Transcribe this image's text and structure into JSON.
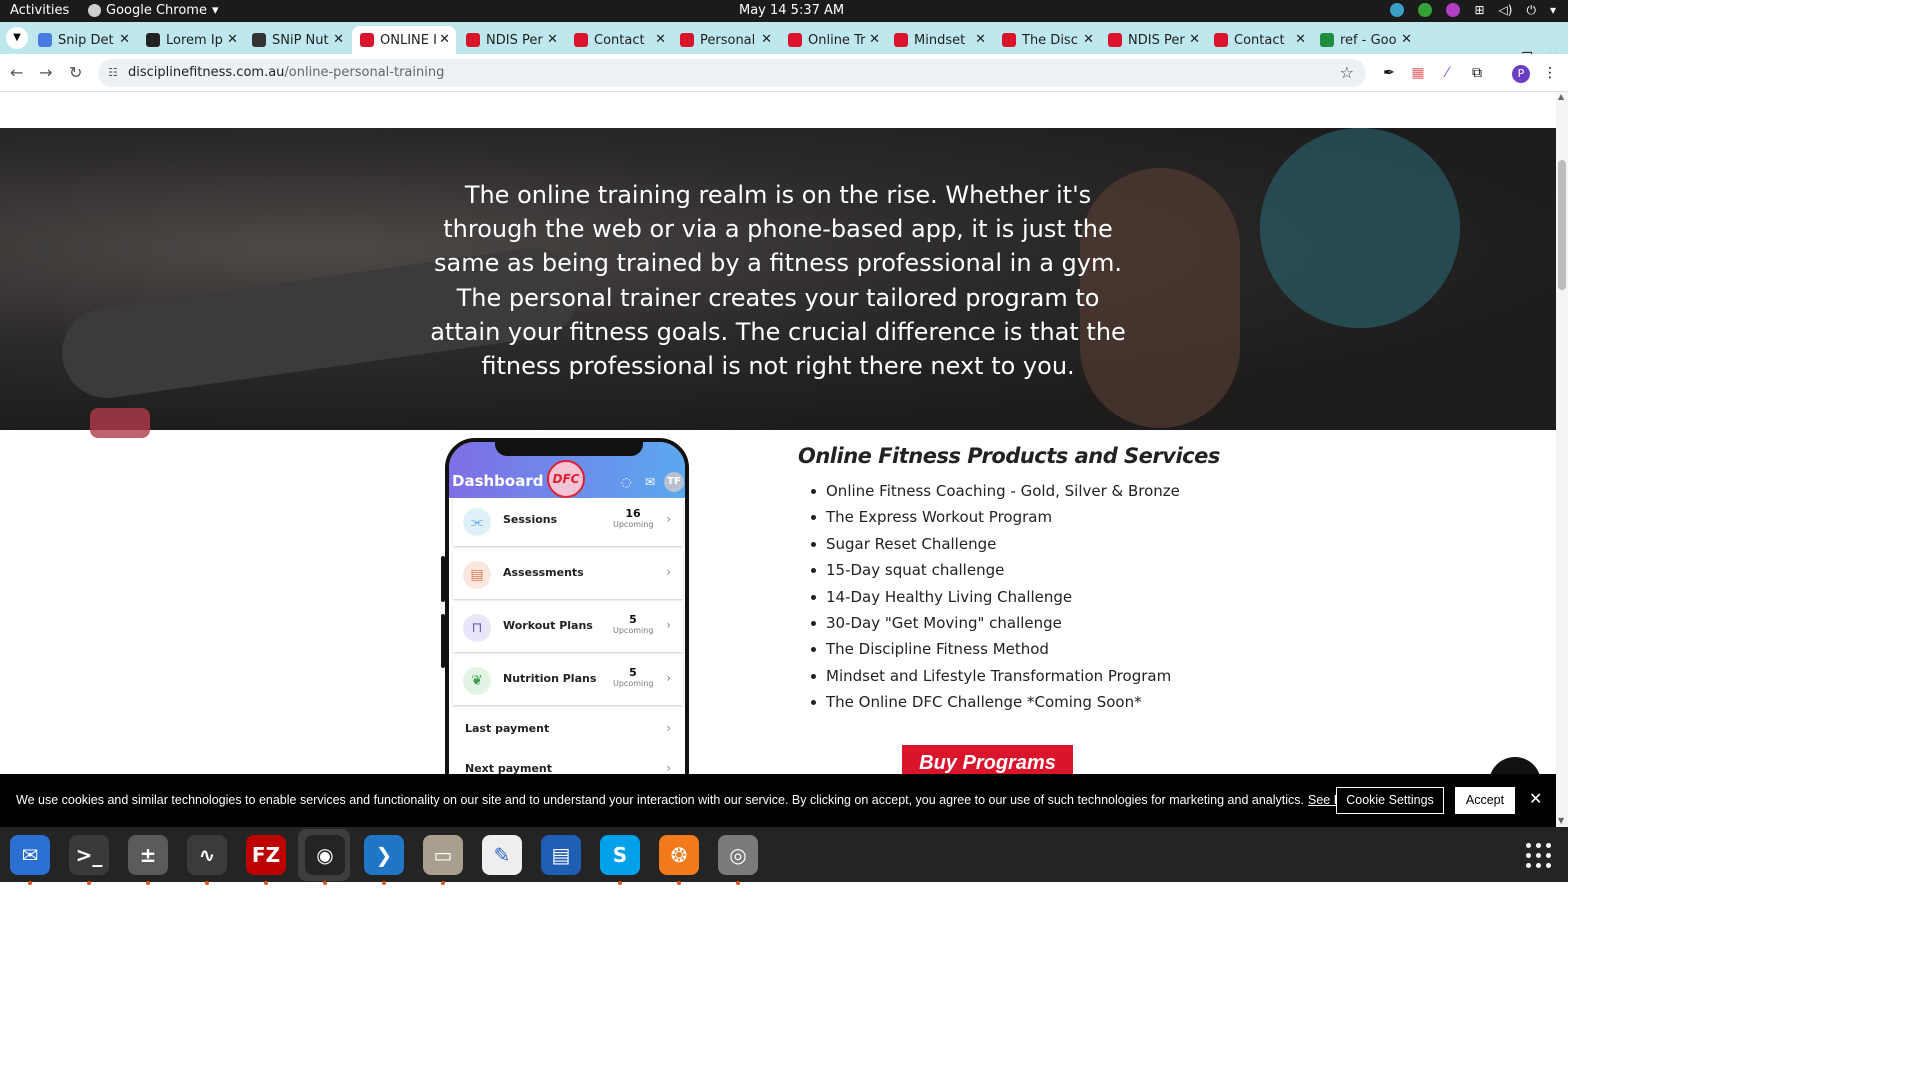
{
  "system": {
    "activities": "Activities",
    "app_name": "Google Chrome",
    "clock": "May 14  5:37 AM"
  },
  "tabs": [
    {
      "title": "Snip Det",
      "favicon_color": "#4a7be0"
    },
    {
      "title": "Lorem Ip",
      "favicon_color": "#222222"
    },
    {
      "title": "SNiP Nut",
      "favicon_color": "#333333"
    },
    {
      "title": "ONLINE I",
      "favicon_color": "#d9142b",
      "active": true
    },
    {
      "title": "NDIS Per",
      "favicon_color": "#d9142b"
    },
    {
      "title": "Contact",
      "favicon_color": "#d9142b"
    },
    {
      "title": "Personal",
      "favicon_color": "#d9142b"
    },
    {
      "title": "Online Tr",
      "favicon_color": "#d9142b"
    },
    {
      "title": "Mindset",
      "favicon_color": "#d9142b"
    },
    {
      "title": "The Disc",
      "favicon_color": "#d9142b"
    },
    {
      "title": "NDIS Per",
      "favicon_color": "#d9142b"
    },
    {
      "title": "Contact",
      "favicon_color": "#d9142b"
    },
    {
      "title": "ref - Goo",
      "favicon_color": "#1e8e3e"
    }
  ],
  "omnibox": {
    "domain": "disciplinefitness.com.au",
    "path": "/online-personal-training"
  },
  "hero": {
    "text": "The online training realm is on the rise. Whether it's through the web or via a phone-based app, it is just the same as being trained by a fitness professional in a gym. The personal trainer creates your tailored program to attain your fitness goals. The crucial difference is that the fitness professional is not right there next to you."
  },
  "phone": {
    "header_title": "Dashboard",
    "logo_text": "DFC",
    "avatar_initials": "TF",
    "rows": [
      {
        "label": "Sessions",
        "count": "16",
        "sub": "Upcoming",
        "icon": "dumbbell-icon",
        "icon_color": "#dff1f8"
      },
      {
        "label": "Assessments",
        "count": "",
        "sub": "",
        "icon": "clipboard-icon",
        "icon_color": "#fbe7df"
      },
      {
        "label": "Workout Plans",
        "count": "5",
        "sub": "Upcoming",
        "icon": "barbell-icon",
        "icon_color": "#e8e6f8"
      },
      {
        "label": "Nutrition Plans",
        "count": "5",
        "sub": "Upcoming",
        "icon": "apple-icon",
        "icon_color": "#e4f4e4"
      }
    ],
    "links": [
      "Last payment",
      "Next payment"
    ]
  },
  "services": {
    "title": "Online Fitness Products and Services",
    "items": [
      "Online Fitness Coaching - Gold, Silver & Bronze",
      "The Express Workout Program",
      "Sugar Reset Challenge",
      "15-Day squat challenge",
      "14-Day Healthy Living Challenge",
      "30-Day \"Get Moving\" challenge",
      "The Discipline Fitness Method",
      "Mindset and Lifestyle Transformation Program",
      "The Online DFC Challenge *Coming Soon*"
    ],
    "buy_label": "Buy Programs"
  },
  "cookie": {
    "message": "We use cookies and similar technologies to enable services and functionality on our site and to understand your interaction with our service. By clicking on accept, you agree to our use of such technologies for marketing and analytics.",
    "link": "See Privacy Policy",
    "settings_label": "Cookie Settings",
    "accept_label": "Accept"
  },
  "dock": [
    {
      "name": "thunderbird-icon",
      "glyph": "✉",
      "bg": "#2a6fd1"
    },
    {
      "name": "terminal-icon",
      "glyph": ">_",
      "bg": "#3a3a3a"
    },
    {
      "name": "calculator-icon",
      "glyph": "±",
      "bg": "#5b5b5b"
    },
    {
      "name": "system-monitor-icon",
      "glyph": "∿",
      "bg": "#3b3b3b"
    },
    {
      "name": "filezilla-icon",
      "glyph": "FZ",
      "bg": "#bf0000"
    },
    {
      "name": "chrome-icon",
      "glyph": "◉",
      "bg": "#242424"
    },
    {
      "name": "vscode-icon",
      "glyph": "❯",
      "bg": "#1f76c6"
    },
    {
      "name": "files-icon",
      "glyph": "▭",
      "bg": "#a89f8e"
    },
    {
      "name": "text-editor-icon",
      "glyph": "✎",
      "bg": "#eeeeee"
    },
    {
      "name": "writer-icon",
      "glyph": "▤",
      "bg": "#1e5fb4"
    },
    {
      "name": "skype-icon",
      "glyph": "S",
      "bg": "#00a1e9"
    },
    {
      "name": "firefox-dev-icon",
      "glyph": "❂",
      "bg": "#f27a1a"
    },
    {
      "name": "disks-icon",
      "glyph": "◎",
      "bg": "#7a7a7a"
    }
  ]
}
